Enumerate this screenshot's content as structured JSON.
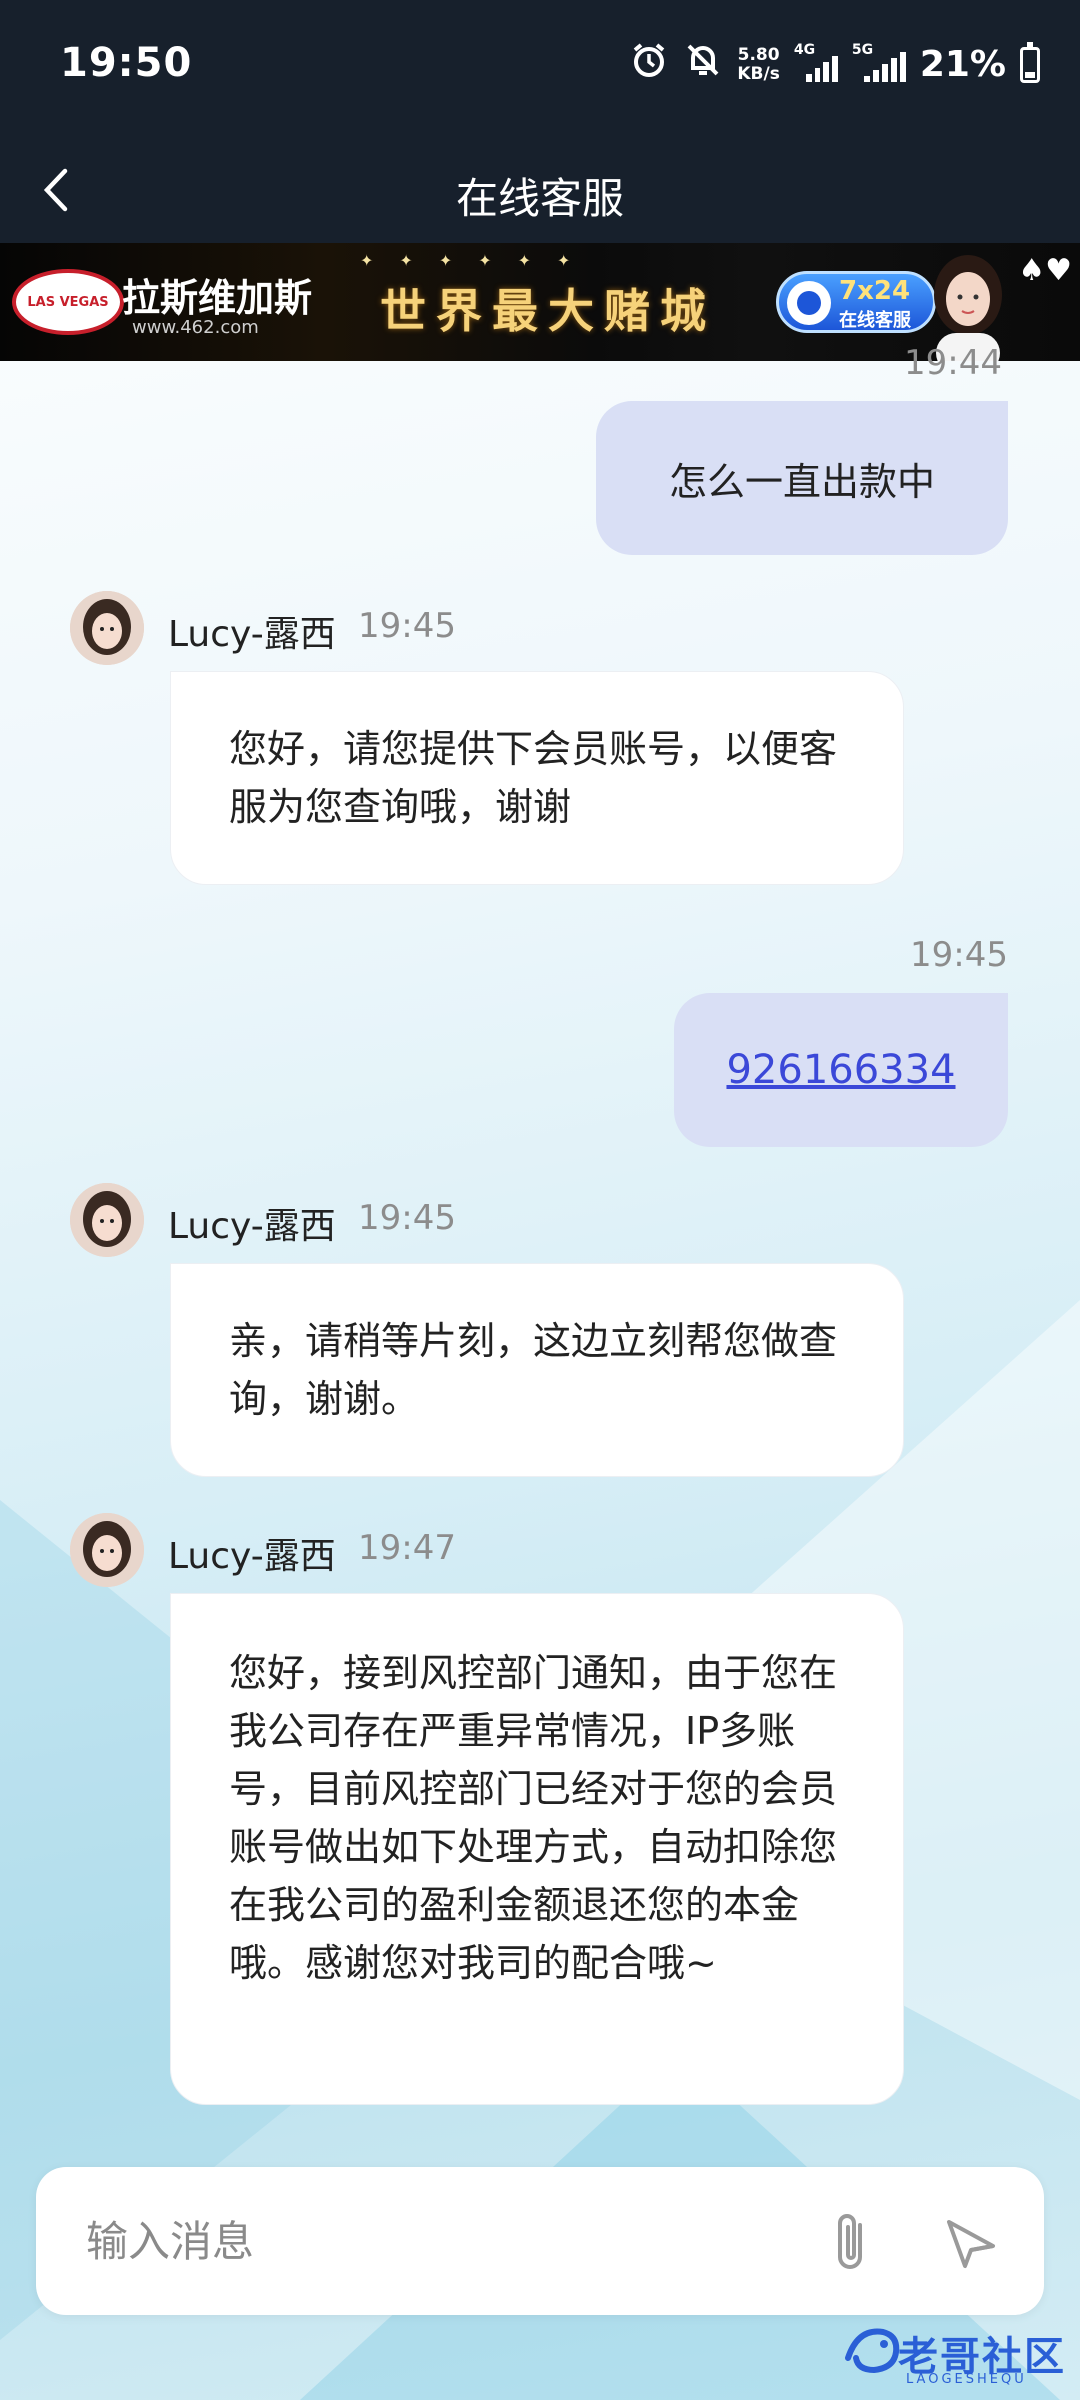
{
  "status_bar": {
    "time": "19:50",
    "net_speed_value": "5.80",
    "net_speed_unit": "KB/s",
    "sim1_label": "4G",
    "sim2_label": "5G",
    "battery_percent": "21%",
    "battery_level": 0.21
  },
  "header": {
    "title": "在线客服"
  },
  "banner": {
    "sign_text": "LAS VEGAS",
    "brand": "拉斯维加斯",
    "url": "www.462.com",
    "slogan": "世界最大赌城",
    "cs_line1": "7x24",
    "cs_line2": "在线客服"
  },
  "chat": {
    "cut_timestamp": "19:44",
    "messages": [
      {
        "from": "user",
        "text": "怎么一直出款中"
      },
      {
        "from": "agent",
        "name": "Lucy-露西",
        "time": "19:45",
        "text": "您好，请您提供下会员账号，以便客服为您查询哦，谢谢"
      },
      {
        "from": "user",
        "time": "19:45",
        "text": "926166334"
      },
      {
        "from": "agent",
        "name": "Lucy-露西",
        "time": "19:45",
        "text": "亲，请稍等片刻，这边立刻帮您做查询，谢谢。"
      },
      {
        "from": "agent",
        "name": "Lucy-露西",
        "time": "19:47",
        "text": "您好，接到风控部门通知，由于您在我公司存在严重异常情况，IP多账号，目前风控部门已经对于您的会员账号做出如下处理方式，自动扣除您在我公司的盈利金额退还您的本金哦。感谢您对我司的配合哦~"
      }
    ]
  },
  "input": {
    "placeholder": "输入消息"
  },
  "watermark": {
    "text": "老哥社区",
    "sub": "LAOGESHEQU"
  },
  "colors": {
    "header_bg": "#17202c",
    "user_bubble": "#d9dff5",
    "agent_bubble": "#ffffff",
    "link": "#3b48d8"
  }
}
